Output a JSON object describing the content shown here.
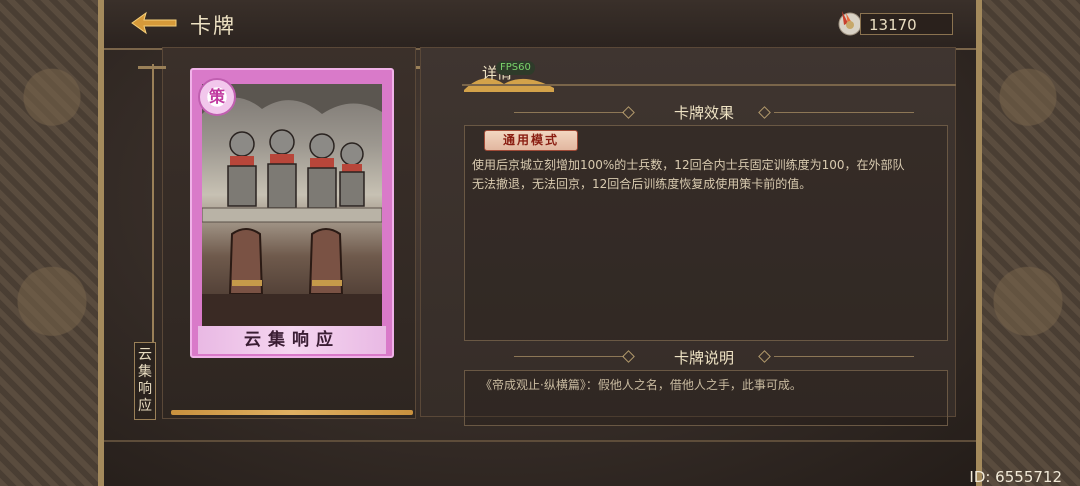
{
  "header": {
    "title": "卡牌",
    "currency_value": "13170"
  },
  "card": {
    "name": "云集响应",
    "rarity": "策",
    "vertical_label": "云集响应"
  },
  "tab": {
    "label": "详情",
    "fps": "FPS60"
  },
  "effect": {
    "title": "卡牌效果",
    "mode_tag": "通用模式",
    "text": "使用后京城立刻增加100%的士兵数，12回合内士兵固定训练度为100，在外部队无法撤退，无法回京，12回合后训练度恢复成使用策卡前的值。"
  },
  "description": {
    "title": "卡牌说明",
    "text": "《帝成观止·纵横篇》：假他人之名，借他人之手，此事可成。"
  },
  "footer": {
    "id": "ID: 6555712"
  },
  "colors": {
    "gold": "#9a8058",
    "card_pink": "#d97ac9",
    "text_light": "#efe3c4"
  }
}
